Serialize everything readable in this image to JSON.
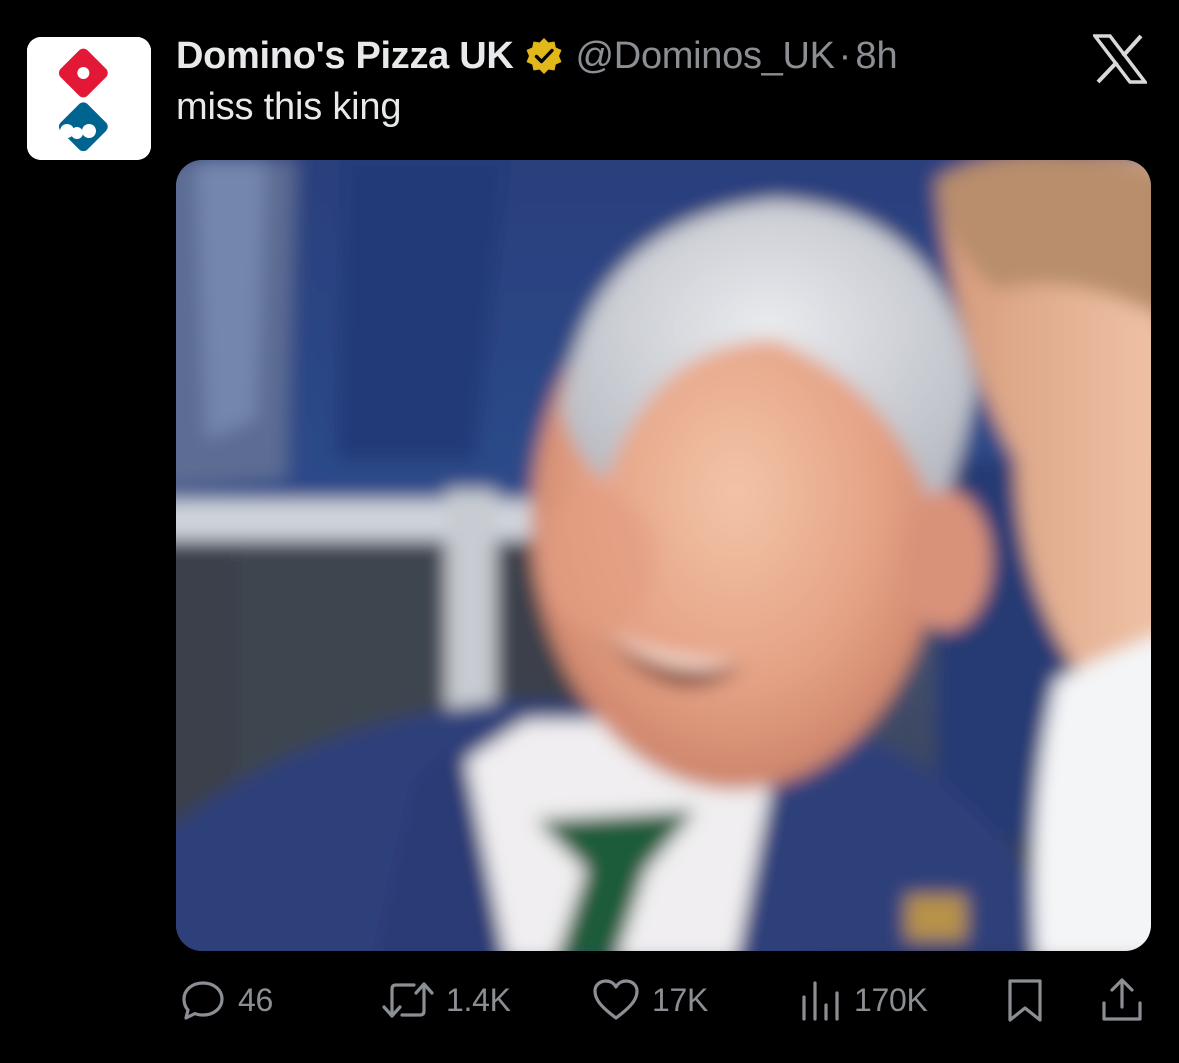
{
  "tweet": {
    "author": {
      "display_name": "Domino's Pizza UK",
      "handle": "@Dominos_UK",
      "verified": true,
      "verified_badge_color": "#e2b719",
      "avatar_icon": "dominos-logo-icon"
    },
    "separator": "·",
    "timestamp": "8h",
    "text": "miss this king",
    "platform_icon": "x-logo-icon",
    "media": {
      "type": "photo",
      "icon": "photo-icon"
    },
    "actions": {
      "replies": {
        "icon": "reply-icon",
        "count": "46"
      },
      "reposts": {
        "icon": "repost-icon",
        "count": "1.4K"
      },
      "likes": {
        "icon": "heart-icon",
        "count": "17K"
      },
      "views": {
        "icon": "views-icon",
        "count": "170K"
      },
      "bookmark": {
        "icon": "bookmark-icon"
      },
      "share": {
        "icon": "share-icon"
      }
    }
  },
  "colors": {
    "background": "#000000",
    "primary_text": "#e7e9ea",
    "secondary_text": "#8b8f94",
    "dominos_red": "#e31837",
    "dominos_blue": "#006491"
  }
}
